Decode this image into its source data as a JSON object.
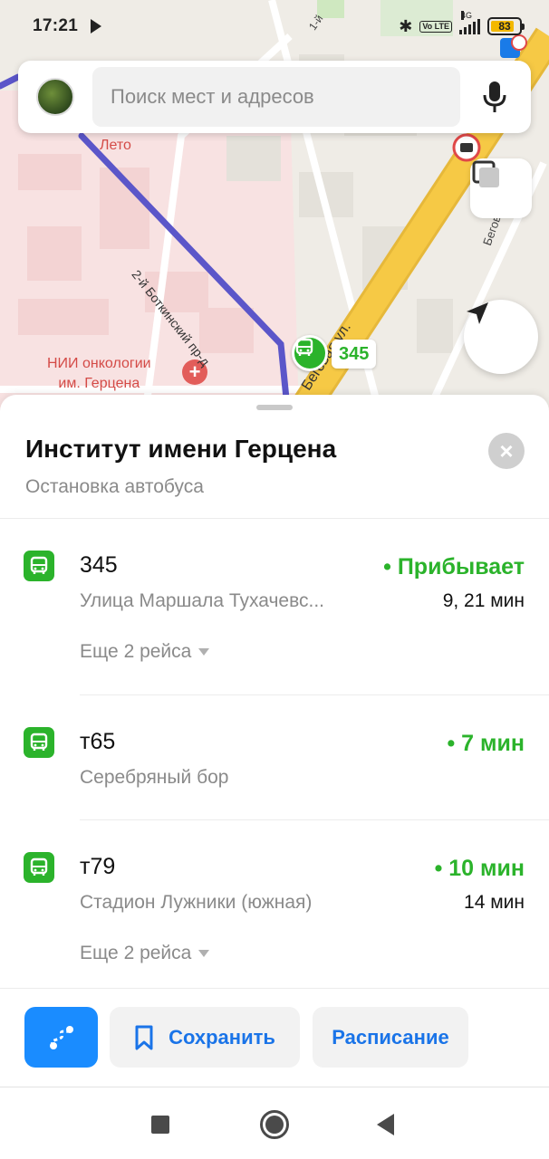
{
  "status_bar": {
    "time": "17:21",
    "battery": "83",
    "battery_level": 0.83,
    "network": "4G",
    "volte": "Vo LTE"
  },
  "search": {
    "placeholder": "Поиск мест и адресов"
  },
  "map": {
    "labels": {
      "leto": "Лето",
      "hospital_line1": "НИИ онкологии",
      "hospital_line2": "им. Герцена",
      "street_botkinsky": "2-й Боткинский пр-д",
      "street_begovaya": "Беговая ул.",
      "street_begovaya_short": "Бегов...",
      "street_1st": "1-й"
    },
    "stop_route": "345",
    "colors": {
      "route_line": "#5b56c9",
      "highway": "#f6c945",
      "stop_green": "#2bb32b",
      "hospital_red": "#d44b47"
    }
  },
  "stop": {
    "title": "Институт имени Герцена",
    "subtitle": "Остановка автобуса",
    "routes": [
      {
        "number": "345",
        "destination": "Улица Маршала Тухачевс...",
        "status": "• Прибывает",
        "next": "9, 21 мин",
        "more": "Еще 2 рейса"
      },
      {
        "number": "т65",
        "destination": "Серебряный бор",
        "status": "• 7 мин",
        "next": "",
        "more": ""
      },
      {
        "number": "т79",
        "destination": "Стадион Лужники (южная)",
        "status": "• 10 мин",
        "next": "14 мин",
        "more": "Еще 2 рейса"
      }
    ]
  },
  "actions": {
    "save_label": "Сохранить",
    "schedule_label": "Расписание",
    "route_icon": "route-icon"
  },
  "colors": {
    "accent_blue": "#1a8cff",
    "link_blue": "#1a74e8",
    "green": "#2bb32b"
  }
}
